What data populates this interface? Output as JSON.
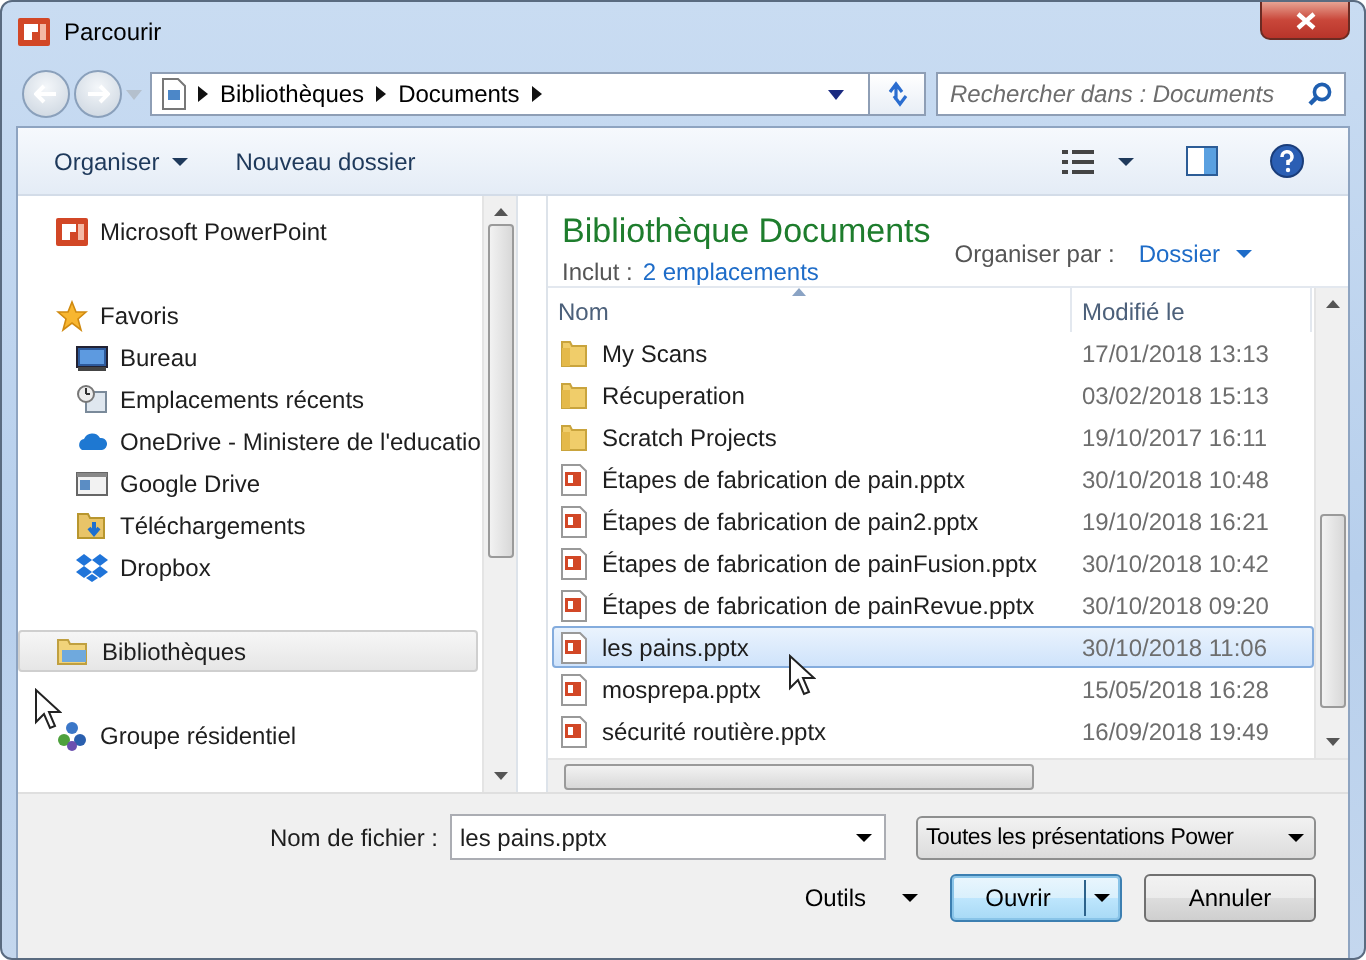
{
  "window": {
    "title": "Parcourir"
  },
  "nav": {
    "breadcrumb": [
      "Bibliothèques",
      "Documents"
    ],
    "search": {
      "placeholder": "Rechercher dans : Documents"
    }
  },
  "toolbar": {
    "organize": "Organiser",
    "new_folder": "Nouveau dossier"
  },
  "sidebar": {
    "items": [
      {
        "label": "Microsoft PowerPoint",
        "selected": false
      },
      {
        "label": "Favoris",
        "selected": false,
        "children": [
          {
            "label": "Bureau",
            "selected": false
          },
          {
            "label": "Emplacements récents",
            "selected": false
          },
          {
            "label": "OneDrive - Ministere de l'educatio",
            "selected": false
          },
          {
            "label": "Google Drive",
            "selected": false
          },
          {
            "label": "Téléchargements",
            "selected": false
          },
          {
            "label": "Dropbox",
            "selected": false
          }
        ]
      },
      {
        "label": "Bibliothèques",
        "selected": true
      },
      {
        "label": "Groupe résidentiel",
        "selected": false
      }
    ]
  },
  "library": {
    "title": "Bibliothèque Documents",
    "includes_label": "Inclut :",
    "includes_link": "2 emplacements",
    "arrange_label": "Organiser par :",
    "arrange_value": "Dossier"
  },
  "table": {
    "columns": [
      "Nom",
      "Modifié le"
    ],
    "rows": [
      {
        "kind": "folder",
        "name": "My Scans",
        "modified": "17/01/2018 13:13",
        "selected": false
      },
      {
        "kind": "folder",
        "name": "Récuperation",
        "modified": "03/02/2018 15:13",
        "selected": false
      },
      {
        "kind": "folder",
        "name": "Scratch Projects",
        "modified": "19/10/2017 16:11",
        "selected": false
      },
      {
        "kind": "pptx",
        "name": "Étapes de fabrication de pain.pptx",
        "modified": "30/10/2018 10:48",
        "selected": false
      },
      {
        "kind": "pptx",
        "name": "Étapes de fabrication de pain2.pptx",
        "modified": "19/10/2018 16:21",
        "selected": false
      },
      {
        "kind": "pptx",
        "name": "Étapes de fabrication de painFusion.pptx",
        "modified": "30/10/2018 10:42",
        "selected": false
      },
      {
        "kind": "pptx",
        "name": "Étapes de fabrication de painRevue.pptx",
        "modified": "30/10/2018 09:20",
        "selected": false
      },
      {
        "kind": "pptx",
        "name": "les pains.pptx",
        "modified": "30/10/2018 11:06",
        "selected": true
      },
      {
        "kind": "pptx",
        "name": "mosprepa.pptx",
        "modified": "15/05/2018 16:28",
        "selected": false
      },
      {
        "kind": "pptx",
        "name": "sécurité routière.pptx",
        "modified": "16/09/2018 19:49",
        "selected": false
      }
    ]
  },
  "footer": {
    "filename_label": "Nom de fichier :",
    "filename": "les pains.pptx",
    "filetype": "Toutes les présentations Power",
    "tools": "Outils",
    "open": "Ouvrir",
    "cancel": "Annuler"
  }
}
